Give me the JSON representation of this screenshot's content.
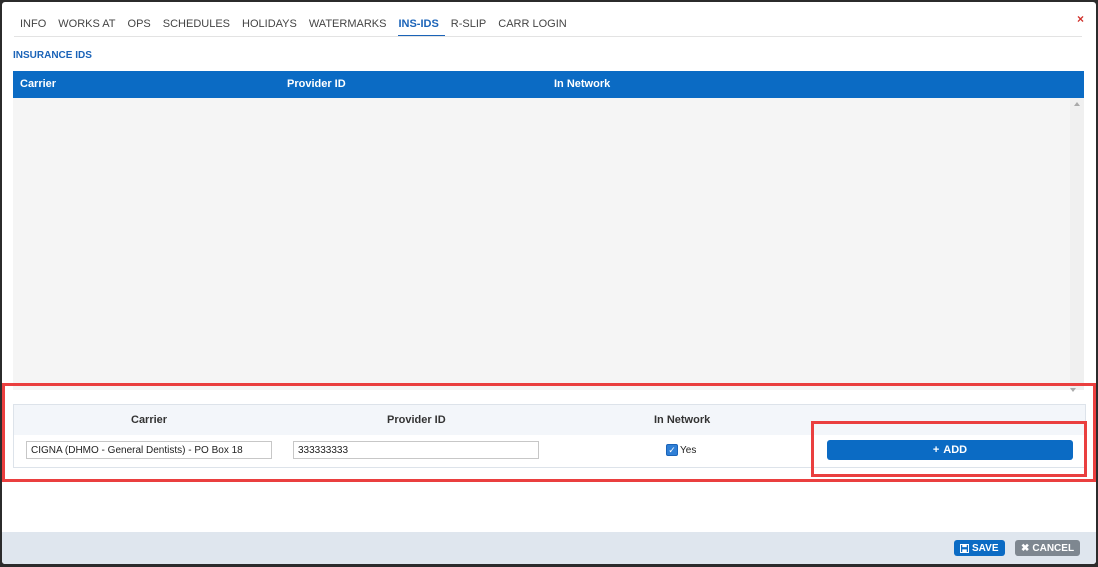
{
  "tabs": [
    "INFO",
    "WORKS AT",
    "OPS",
    "SCHEDULES",
    "HOLIDAYS",
    "WATERMARKS",
    "INS-IDS",
    "R-SLIP",
    "CARR LOGIN"
  ],
  "active_tab": "INS-IDS",
  "close_label": "×",
  "section_title": "INSURANCE IDS",
  "grid": {
    "columns": [
      "Carrier",
      "Provider ID",
      "In Network"
    ]
  },
  "add_form": {
    "columns": [
      "Carrier",
      "Provider ID",
      "In Network"
    ],
    "carrier_value": "CIGNA (DHMO - General Dentists) - PO Box 18",
    "provider_id_value": "333333333",
    "in_network_label": "Yes",
    "in_network_checked": true,
    "add_label": "ADD",
    "add_icon": "+"
  },
  "footer": {
    "save_label": "SAVE",
    "cancel_label": "CANCEL",
    "save_icon": "floppy-disk-icon",
    "cancel_icon": "x-icon"
  },
  "colors": {
    "accent": "#0b6bc4",
    "highlight": "#ea3f3f"
  }
}
